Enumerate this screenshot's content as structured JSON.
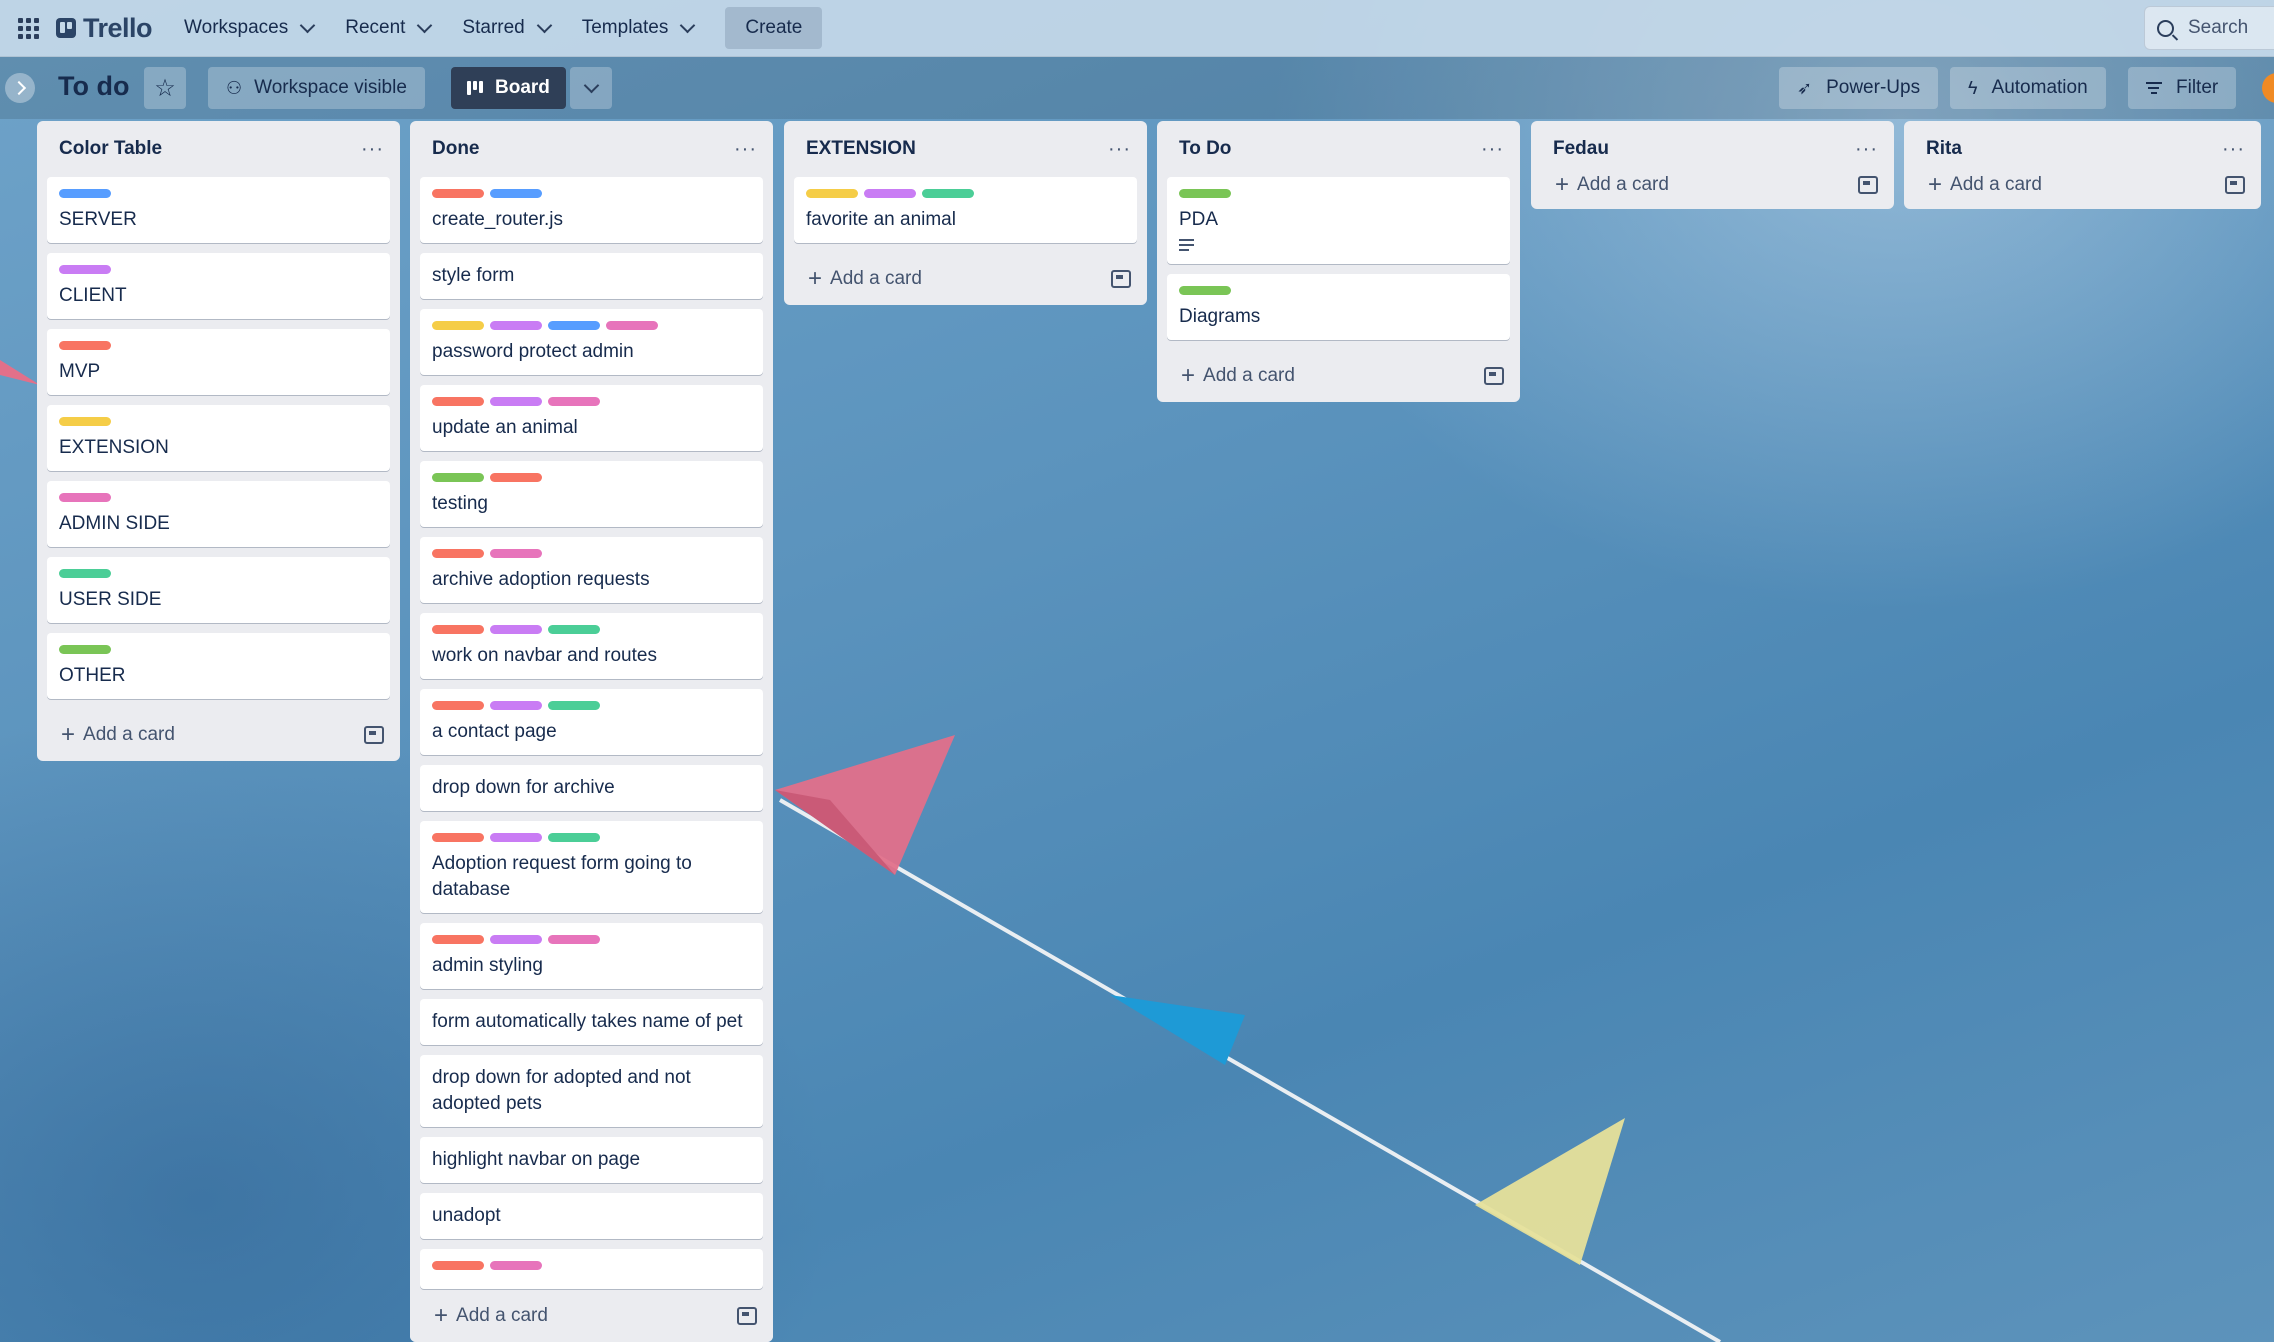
{
  "app": {
    "name": "Trello"
  },
  "topnav": {
    "items": [
      {
        "label": "Workspaces"
      },
      {
        "label": "Recent"
      },
      {
        "label": "Starred"
      },
      {
        "label": "Templates"
      }
    ],
    "create_label": "Create",
    "search_placeholder": "Search"
  },
  "board": {
    "title": "To do",
    "visibility_label": "Workspace visible",
    "view_label": "Board",
    "powerups_label": "Power-Ups",
    "automation_label": "Automation",
    "filter_label": "Filter"
  },
  "colors": {
    "red": "#f87462",
    "blue": "#579dff",
    "purple": "#c97cf4",
    "yellow": "#f5cd47",
    "pink": "#e774bb",
    "mint": "#4bce97",
    "green": "#7ac556"
  },
  "add_card_label": "Add a card",
  "lists": [
    {
      "title": "Color Table",
      "cards": [
        {
          "title": "SERVER",
          "labels": [
            "blue"
          ]
        },
        {
          "title": "CLIENT",
          "labels": [
            "purple"
          ]
        },
        {
          "title": "MVP",
          "labels": [
            "red"
          ]
        },
        {
          "title": "EXTENSION",
          "labels": [
            "yellow"
          ]
        },
        {
          "title": "ADMIN SIDE",
          "labels": [
            "pink"
          ]
        },
        {
          "title": "USER SIDE",
          "labels": [
            "mint"
          ]
        },
        {
          "title": "OTHER",
          "labels": [
            "green"
          ]
        }
      ]
    },
    {
      "title": "Done",
      "cards": [
        {
          "title": "create_router.js",
          "labels": [
            "red",
            "blue"
          ]
        },
        {
          "title": "style form",
          "labels": []
        },
        {
          "title": "password protect admin",
          "labels": [
            "yellow",
            "purple",
            "blue",
            "pink"
          ]
        },
        {
          "title": "update an animal",
          "labels": [
            "red",
            "purple",
            "pink"
          ]
        },
        {
          "title": "testing",
          "labels": [
            "green",
            "red"
          ]
        },
        {
          "title": "archive adoption requests",
          "labels": [
            "red",
            "pink"
          ]
        },
        {
          "title": "work on navbar and routes",
          "labels": [
            "red",
            "purple",
            "mint"
          ]
        },
        {
          "title": "a contact page",
          "labels": [
            "red",
            "purple",
            "mint"
          ]
        },
        {
          "title": "drop down for archive",
          "labels": []
        },
        {
          "title": "Adoption request form going to database",
          "labels": [
            "red",
            "purple",
            "mint"
          ]
        },
        {
          "title": "admin styling",
          "labels": [
            "red",
            "purple",
            "pink"
          ]
        },
        {
          "title": "form automatically takes name of pet",
          "labels": []
        },
        {
          "title": "drop down for adopted and not adopted pets",
          "labels": []
        },
        {
          "title": "highlight navbar on page",
          "labels": []
        },
        {
          "title": "unadopt",
          "labels": []
        },
        {
          "title": "",
          "labels": [
            "red",
            "pink"
          ]
        }
      ]
    },
    {
      "title": "EXTENSION",
      "cards": [
        {
          "title": "favorite an animal",
          "labels": [
            "yellow",
            "purple",
            "mint"
          ]
        }
      ]
    },
    {
      "title": "To Do",
      "cards": [
        {
          "title": "PDA",
          "labels": [
            "green"
          ],
          "has_description": true
        },
        {
          "title": "Diagrams",
          "labels": [
            "green"
          ]
        }
      ]
    },
    {
      "title": "Fedau",
      "cards": []
    },
    {
      "title": "Rita",
      "cards": []
    }
  ]
}
